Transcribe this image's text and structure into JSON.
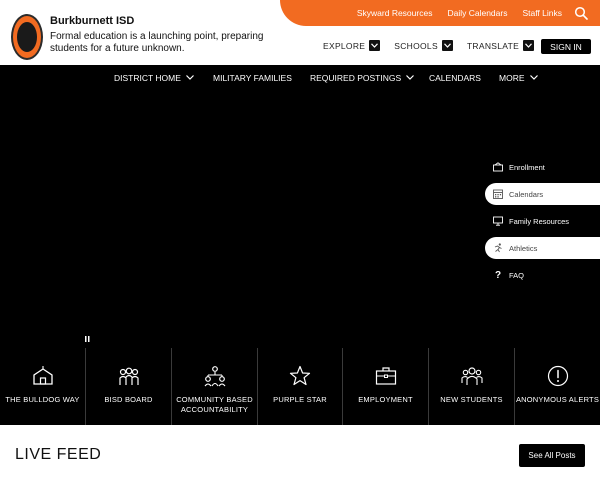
{
  "header": {
    "district_name": "Burkburnett ISD",
    "tagline": "Formal education is a launching point, preparing students for a future unknown.",
    "quicklinks": [
      "Skyward Resources",
      "Daily Calendars",
      "Staff Links"
    ],
    "nav": [
      "EXPLORE",
      "SCHOOLS",
      "TRANSLATE"
    ],
    "signin_label": "SIGN IN"
  },
  "main_nav": {
    "items": [
      "DISTRICT HOME",
      "MILITARY FAMILIES",
      "REQUIRED POSTINGS",
      "CALENDARS",
      "MORE"
    ]
  },
  "quick_menu": {
    "items": [
      "Enrollment",
      "Calendars",
      "Family Resources",
      "Athletics",
      "FAQ"
    ],
    "faq_glyph": "?"
  },
  "icon_bar": {
    "items": [
      {
        "line1": "THE BULLDOG WAY",
        "line2": ""
      },
      {
        "line1": "BISD BOARD",
        "line2": ""
      },
      {
        "line1": "COMMUNITY BASED",
        "line2": "ACCOUNTABILITY"
      },
      {
        "line1": "PURPLE STAR",
        "line2": ""
      },
      {
        "line1": "EMPLOYMENT",
        "line2": ""
      },
      {
        "line1": "NEW STUDENTS",
        "line2": ""
      },
      {
        "line1": "ANONYMOUS ALERTS",
        "line2": ""
      }
    ]
  },
  "feed": {
    "title": "LIVE FEED",
    "see_all_label": "See All Posts"
  },
  "colors": {
    "accent": "#f26b21",
    "background": "#000000",
    "header_bg": "#ffffff"
  }
}
